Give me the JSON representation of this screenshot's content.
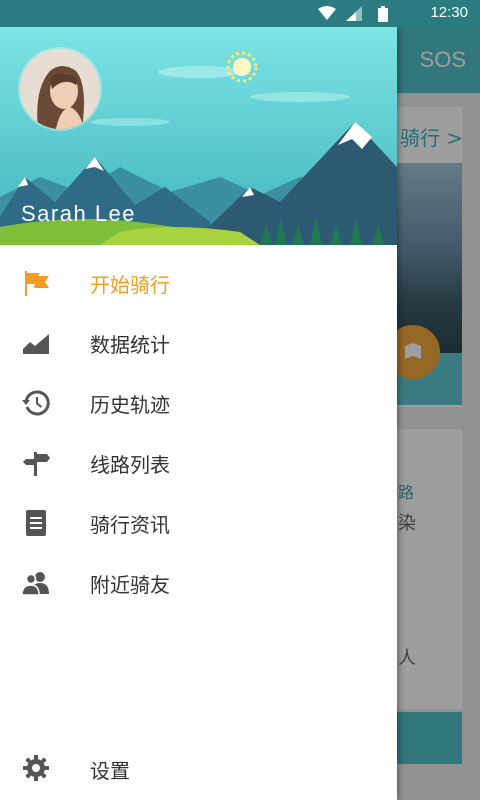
{
  "status_bar": {
    "time": "12:30"
  },
  "background": {
    "toolbar_action": "SOS",
    "card_title_fragment": "骑行",
    "text_fragment_1": "路",
    "text_fragment_2": "染",
    "text_fragment_3": "人"
  },
  "drawer": {
    "user_name": "Sarah Lee",
    "menu": [
      {
        "label": "开始骑行",
        "icon": "flag-icon",
        "active": true
      },
      {
        "label": "数据统计",
        "icon": "area-chart-icon",
        "active": false
      },
      {
        "label": "历史轨迹",
        "icon": "history-icon",
        "active": false
      },
      {
        "label": "线路列表",
        "icon": "signpost-icon",
        "active": false
      },
      {
        "label": "骑行资讯",
        "icon": "document-icon",
        "active": false
      },
      {
        "label": "附近骑友",
        "icon": "people-icon",
        "active": false
      }
    ],
    "settings_label": "设置"
  },
  "colors": {
    "active": "#f39b22",
    "icon": "#555555",
    "header_sky": "#5fd2d6",
    "status_bar": "#2a7c80"
  }
}
